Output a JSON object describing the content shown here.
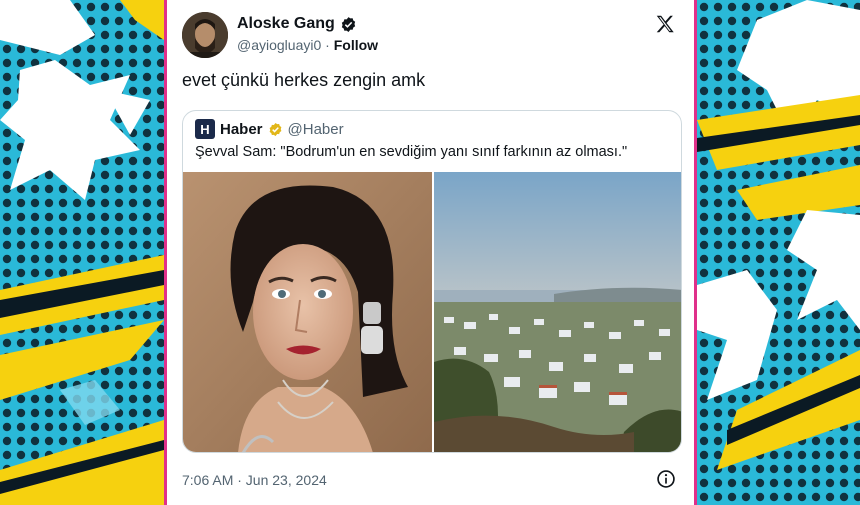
{
  "tweet": {
    "display_name": "Aloske Gang",
    "handle": "@ayiogluayi0",
    "separator": "·",
    "follow_label": "Follow",
    "text": "evet çünkü herkes zengin amk",
    "timestamp": "7:06 AM · Jun 23, 2024"
  },
  "quoted": {
    "logo_letter": "H",
    "display_name": "Haber",
    "handle": "@Haber",
    "text": "Şevval Sam: \"Bodrum'un en sevdiğim yanı sınıf farkının az olması.\""
  },
  "colors": {
    "frame": "#e0308a",
    "background_pattern": "#29b8d6",
    "accent_yellow": "#f6d10f",
    "verified": "#1d9bf0",
    "gold_verified": "#e2b719"
  },
  "icons": [
    "verified-badge-icon",
    "x-logo-icon",
    "gold-verified-badge-icon",
    "info-icon"
  ]
}
